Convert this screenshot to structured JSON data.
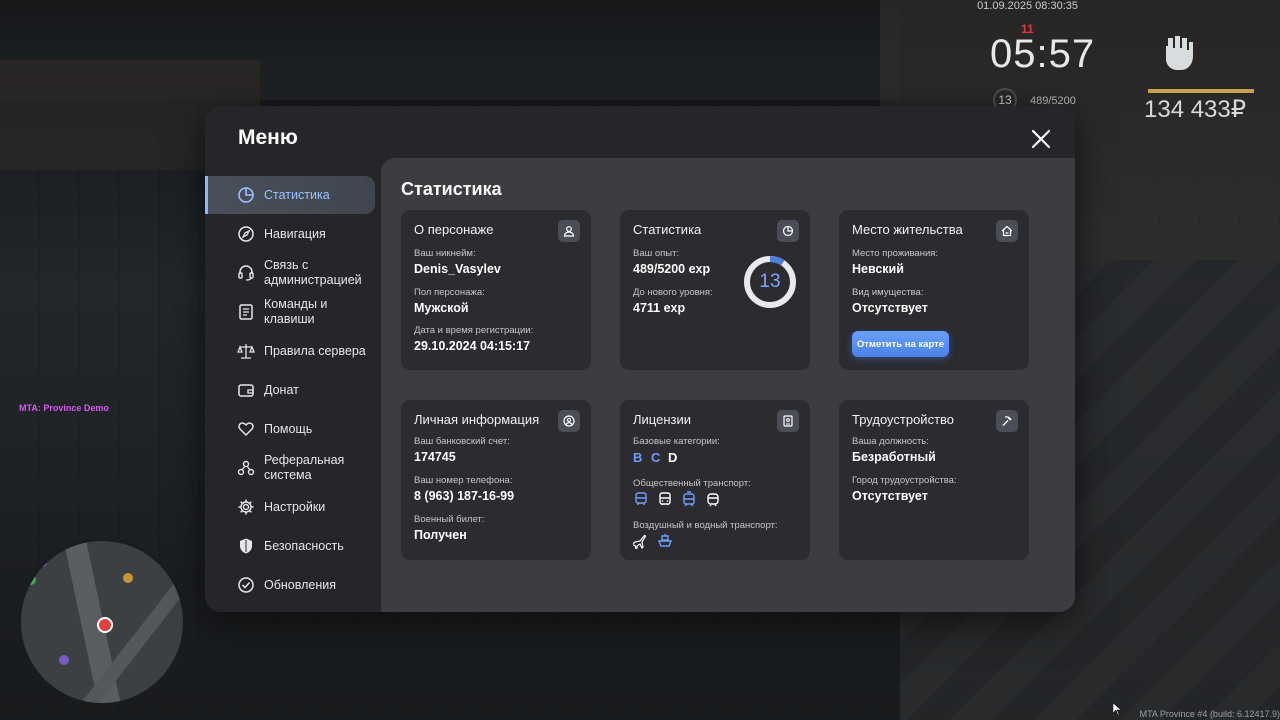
{
  "hud": {
    "datetime": "01.09.2025 08:30:35",
    "time": "05:57",
    "wanted": "11",
    "level": "13",
    "exp": "489/5200",
    "money": "134 433₽",
    "server_label": "MTA: Province Demo",
    "build": "MTA Province #4 (build: 6.12417.9)"
  },
  "menu": {
    "title": "Меню",
    "sidebar": [
      {
        "label": "Статистика",
        "icon": "pie-chart-icon",
        "active": true
      },
      {
        "label": "Навигация",
        "icon": "compass-icon"
      },
      {
        "label": "Связь с администрацией",
        "icon": "headset-icon"
      },
      {
        "label": "Команды и клавиши",
        "icon": "document-icon"
      },
      {
        "label": "Правила сервера",
        "icon": "scales-icon"
      },
      {
        "label": "Донат",
        "icon": "wallet-icon"
      },
      {
        "label": "Помощь",
        "icon": "heart-hands-icon"
      },
      {
        "label": "Реферальная система",
        "icon": "referral-icon"
      },
      {
        "label": "Настройки",
        "icon": "gear-icon"
      },
      {
        "label": "Безопасность",
        "icon": "shield-icon"
      },
      {
        "label": "Обновления",
        "icon": "check-circle-icon"
      }
    ]
  },
  "stats": {
    "title": "Статистика",
    "character": {
      "title": "О персонаже",
      "nick_label": "Ваш никнейм:",
      "nick": "Denis_Vasylev",
      "gender_label": "Пол персонажа:",
      "gender": "Мужской",
      "reg_label": "Дата и время регистрации:",
      "reg": "29.10.2024 04:15:17"
    },
    "statistics": {
      "title": "Статистика",
      "exp_label": "Ваш опыт:",
      "exp": "489/5200 exp",
      "next_label": "До нового уровня:",
      "next": "4711 exp",
      "level": "13",
      "progress": 0.094
    },
    "residence": {
      "title": "Место жительства",
      "place_label": "Место проживания:",
      "place": "Невский",
      "property_label": "Вид имущества:",
      "property": "Отсутствует",
      "map_button": "Отметить на карте"
    },
    "personal": {
      "title": "Личная информация",
      "bank_label": "Ваш банковский счет:",
      "bank": "174745",
      "phone_label": "Ваш номер телефона:",
      "phone": "8 (963) 187-16-99",
      "military_label": "Военный билет:",
      "military": "Получен"
    },
    "licenses": {
      "title": "Лицензии",
      "base_label": "Базовые категории:",
      "categories": [
        {
          "letter": "B",
          "color": "#6f9dff"
        },
        {
          "letter": "C",
          "color": "#6f9dff"
        },
        {
          "letter": "D",
          "color": "#ffffff"
        }
      ],
      "public_label": "Общественный транспорт:",
      "public_icons": [
        "bus-icon",
        "bus-front-icon",
        "tram-icon",
        "trolleybus-icon"
      ],
      "air_label": "Воздушный и водный транспорт:",
      "air_icons": [
        "plane-icon",
        "boat-icon"
      ]
    },
    "employment": {
      "title": "Трудоустройство",
      "position_label": "Ваша должность:",
      "position": "Безработный",
      "city_label": "Город трудоустройства:",
      "city": "Отсутствует"
    }
  }
}
